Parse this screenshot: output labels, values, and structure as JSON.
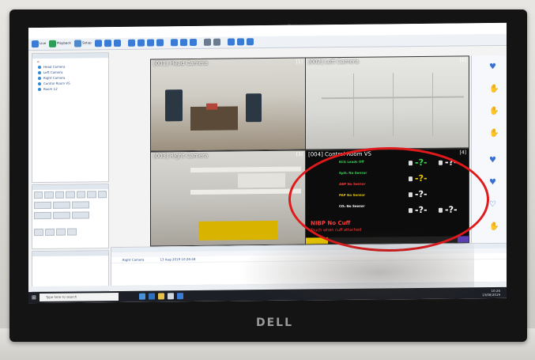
{
  "colors": {
    "bezel": "#141414",
    "accent": "#3a7bd5",
    "annotation": "#e0191b",
    "vs_bg": "#0c0c0c",
    "vs_green": "#39d353",
    "vs_yellow": "#e7c500",
    "vs_red": "#ff3b3b"
  },
  "monitor": {
    "brand": "DELL"
  },
  "toolbar": {
    "live_label": "Live",
    "playback_label": "Playback",
    "setup_label": "Setup"
  },
  "tree": {
    "items": [
      {
        "label": "Head Camera"
      },
      {
        "label": "Left Camera"
      },
      {
        "label": "Right Camera"
      },
      {
        "label": "Control Room VS"
      },
      {
        "label": "Room 12"
      }
    ]
  },
  "tiles": {
    "cam1": {
      "label": "[001] Head Camera",
      "num": "[1]"
    },
    "cam2": {
      "label": "[002] Left Camera",
      "num": "[2]"
    },
    "cam3": {
      "label": "[003] Right Camera",
      "num": "[3]"
    },
    "cam4": {
      "label": "[004] Control Room VS",
      "num": "[4]"
    }
  },
  "vitals": {
    "ecg": "ECG Leads Off",
    "spo2": "SpO₂ No Sensor",
    "abp": "ABP No Sensor",
    "pap": "PAP No Sensor",
    "co2": "CO₂ No Sensor",
    "nibp": "NIBP No Cuff",
    "nibp_sub": "Touch when cuff attached",
    "value": "-?-"
  },
  "eventlog": {
    "row1": {
      "camera": "Right Camera",
      "time": "13 Aug 2019 10:26:48"
    }
  },
  "taskbar": {
    "search_placeholder": "Type here to search",
    "time": "10:26",
    "date": "13/08/2019"
  }
}
